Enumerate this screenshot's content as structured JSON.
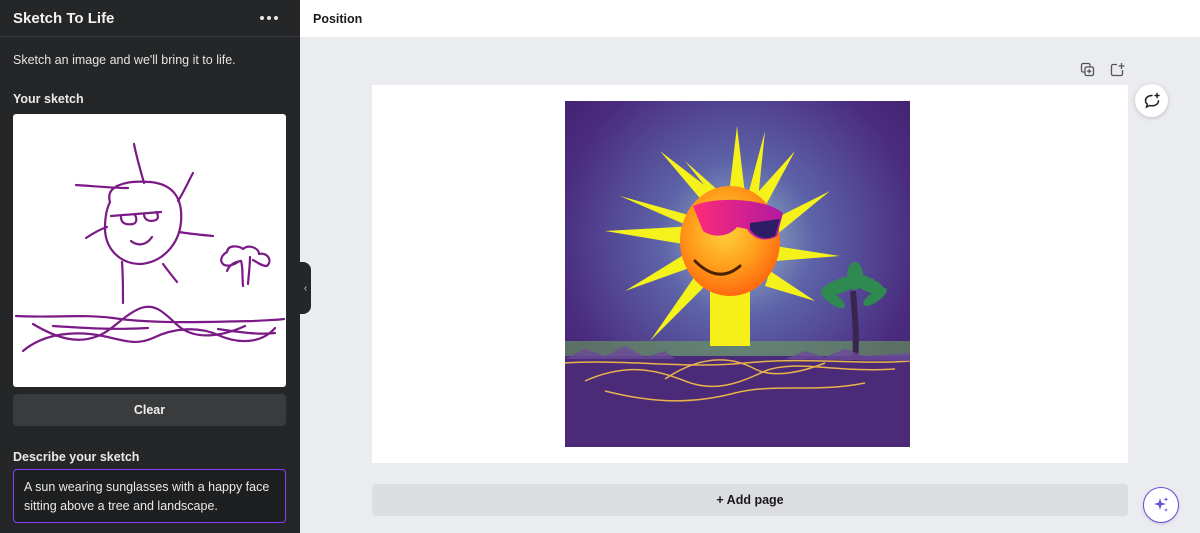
{
  "sidebar": {
    "title": "Sketch To Life",
    "more_icon": "more-horizontal-icon",
    "description": "Sketch an image and we'll bring it to life.",
    "sketch_label": "Your sketch",
    "clear_label": "Clear",
    "describe_label": "Describe your sketch",
    "describe_value": "A sun wearing sunglasses with a happy face sitting above a tree and landscape.",
    "sketch_stroke_color": "#7b1a86"
  },
  "topbar": {
    "position_label": "Position"
  },
  "canvas": {
    "duplicate_icon": "duplicate-page-icon",
    "add_icon": "add-page-icon",
    "comment_icon": "add-comment-icon",
    "add_page_label": "+ Add page",
    "magic_icon": "magic-sparkle-icon"
  },
  "colors": {
    "accent": "#8b3dff",
    "sidebar_bg": "#252627",
    "canvas_bg": "#ebecf0"
  }
}
